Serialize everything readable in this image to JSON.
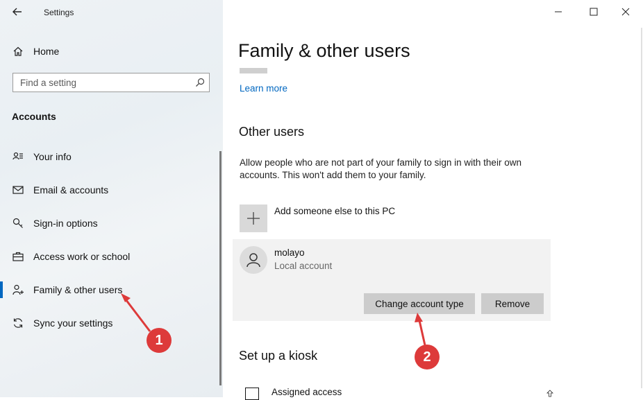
{
  "window": {
    "title": "Settings"
  },
  "sidebar": {
    "home_label": "Home",
    "search_placeholder": "Find a setting",
    "section_title": "Accounts",
    "items": [
      {
        "label": "Your info",
        "icon": "contact-card-icon"
      },
      {
        "label": "Email & accounts",
        "icon": "mail-icon"
      },
      {
        "label": "Sign-in options",
        "icon": "key-icon"
      },
      {
        "label": "Access work or school",
        "icon": "briefcase-icon"
      },
      {
        "label": "Family & other users",
        "icon": "person-add-icon",
        "active": true
      },
      {
        "label": "Sync your settings",
        "icon": "sync-icon"
      }
    ]
  },
  "main": {
    "title": "Family & other users",
    "learn_more": "Learn more",
    "other_users": {
      "heading": "Other users",
      "description": "Allow people who are not part of your family to sign in with their own accounts. This won't add them to your family.",
      "add_label": "Add someone else to this PC"
    },
    "user": {
      "name": "molayo",
      "type": "Local account",
      "change_button": "Change account type",
      "remove_button": "Remove"
    },
    "kiosk": {
      "heading": "Set up a kiosk",
      "assigned_access": "Assigned access"
    }
  },
  "annotations": [
    {
      "number": "1"
    },
    {
      "number": "2"
    }
  ],
  "colors": {
    "accent": "#0067c0",
    "annotation": "#dd3a3a"
  }
}
